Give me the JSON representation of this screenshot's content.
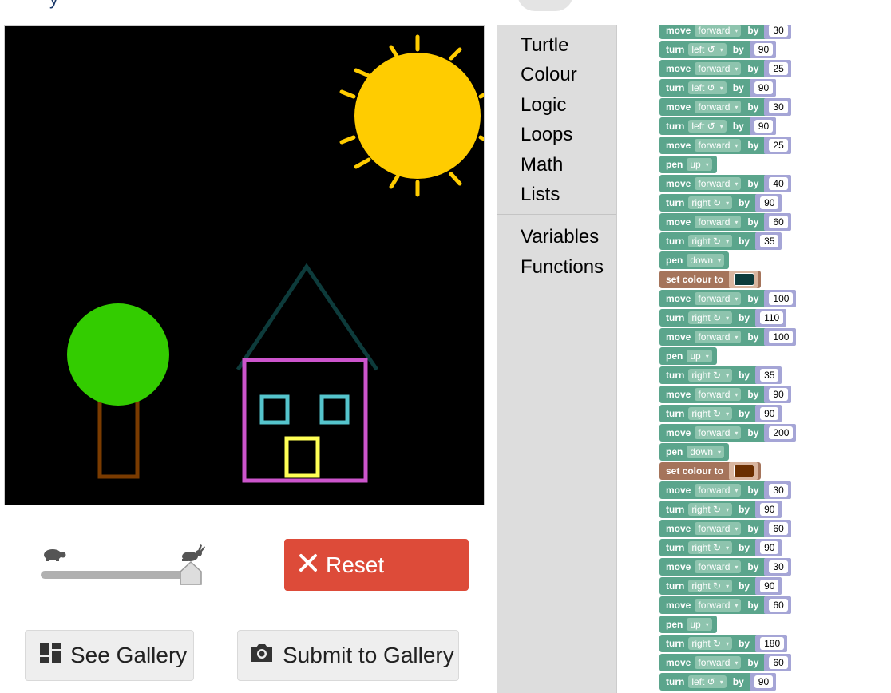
{
  "header": {
    "title_fragment": "y"
  },
  "controls": {
    "reset_label": "Reset",
    "see_gallery_label": "See Gallery",
    "submit_gallery_label": "Submit to Gallery",
    "speed_level": 1.0
  },
  "toolbox": {
    "categories": [
      "Turtle",
      "Colour",
      "Logic",
      "Loops",
      "Math",
      "Lists",
      "Variables",
      "Functions"
    ]
  },
  "blocks": [
    {
      "kind": "move",
      "label": "move",
      "option": "forward",
      "by": "by",
      "value": "30"
    },
    {
      "kind": "turn",
      "label": "turn",
      "option": "left ↺",
      "by": "by",
      "value": "90"
    },
    {
      "kind": "move",
      "label": "move",
      "option": "forward",
      "by": "by",
      "value": "25"
    },
    {
      "kind": "turn",
      "label": "turn",
      "option": "left ↺",
      "by": "by",
      "value": "90"
    },
    {
      "kind": "move",
      "label": "move",
      "option": "forward",
      "by": "by",
      "value": "30"
    },
    {
      "kind": "turn",
      "label": "turn",
      "option": "left ↺",
      "by": "by",
      "value": "90"
    },
    {
      "kind": "move",
      "label": "move",
      "option": "forward",
      "by": "by",
      "value": "25"
    },
    {
      "kind": "pen",
      "label": "pen",
      "option": "up"
    },
    {
      "kind": "move",
      "label": "move",
      "option": "forward",
      "by": "by",
      "value": "40"
    },
    {
      "kind": "turn",
      "label": "turn",
      "option": "right ↻",
      "by": "by",
      "value": "90"
    },
    {
      "kind": "move",
      "label": "move",
      "option": "forward",
      "by": "by",
      "value": "60"
    },
    {
      "kind": "turn",
      "label": "turn",
      "option": "right ↻",
      "by": "by",
      "value": "35"
    },
    {
      "kind": "pen",
      "label": "pen",
      "option": "down"
    },
    {
      "kind": "colour",
      "label": "set colour to",
      "color": "#0d3b3b"
    },
    {
      "kind": "move",
      "label": "move",
      "option": "forward",
      "by": "by",
      "value": "100"
    },
    {
      "kind": "turn",
      "label": "turn",
      "option": "right ↻",
      "by": "by",
      "value": "110"
    },
    {
      "kind": "move",
      "label": "move",
      "option": "forward",
      "by": "by",
      "value": "100"
    },
    {
      "kind": "pen",
      "label": "pen",
      "option": "up"
    },
    {
      "kind": "turn",
      "label": "turn",
      "option": "right ↻",
      "by": "by",
      "value": "35"
    },
    {
      "kind": "move",
      "label": "move",
      "option": "forward",
      "by": "by",
      "value": "90"
    },
    {
      "kind": "turn",
      "label": "turn",
      "option": "right ↻",
      "by": "by",
      "value": "90"
    },
    {
      "kind": "move",
      "label": "move",
      "option": "forward",
      "by": "by",
      "value": "200"
    },
    {
      "kind": "pen",
      "label": "pen",
      "option": "down"
    },
    {
      "kind": "colour",
      "label": "set colour to",
      "color": "#6b2e00"
    },
    {
      "kind": "move",
      "label": "move",
      "option": "forward",
      "by": "by",
      "value": "30"
    },
    {
      "kind": "turn",
      "label": "turn",
      "option": "right ↻",
      "by": "by",
      "value": "90"
    },
    {
      "kind": "move",
      "label": "move",
      "option": "forward",
      "by": "by",
      "value": "60"
    },
    {
      "kind": "turn",
      "label": "turn",
      "option": "right ↻",
      "by": "by",
      "value": "90"
    },
    {
      "kind": "move",
      "label": "move",
      "option": "forward",
      "by": "by",
      "value": "30"
    },
    {
      "kind": "turn",
      "label": "turn",
      "option": "right ↻",
      "by": "by",
      "value": "90"
    },
    {
      "kind": "move",
      "label": "move",
      "option": "forward",
      "by": "by",
      "value": "60"
    },
    {
      "kind": "pen",
      "label": "pen",
      "option": "up"
    },
    {
      "kind": "turn",
      "label": "turn",
      "option": "right ↻",
      "by": "by",
      "value": "180"
    },
    {
      "kind": "move",
      "label": "move",
      "option": "forward",
      "by": "by",
      "value": "60"
    },
    {
      "kind": "turn",
      "label": "turn",
      "option": "left ↺",
      "by": "by",
      "value": "90"
    }
  ],
  "colors": {
    "reset": "#dd4b39",
    "block_green": "#5ba58c",
    "block_colour": "#a5745b",
    "sun": "#ffcc00",
    "tree_top": "#33cc00",
    "trunk": "#7a3b00",
    "roof": "#0d3b3b",
    "house": "#cc55cc",
    "windows": "#55c4cc",
    "door": "#ffff55"
  }
}
